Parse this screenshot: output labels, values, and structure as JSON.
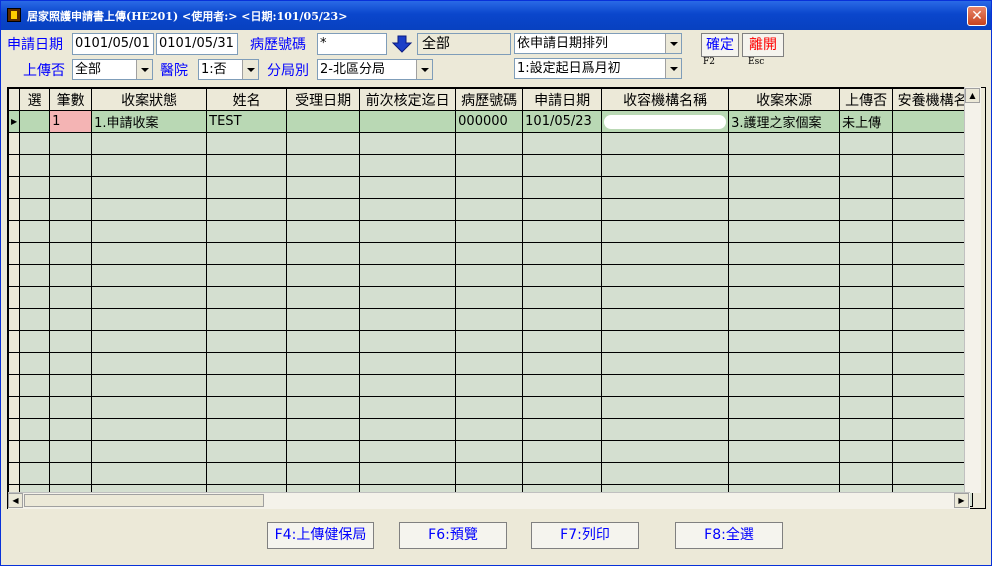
{
  "window": {
    "title": "居家照護申請書上傳(HE201)   <使用者:>    <日期:101/05/23>",
    "close": "✕"
  },
  "filters": {
    "apply_date_label": "申請日期",
    "date_from": "0101/05/01",
    "date_to": "0101/05/31",
    "record_no_label": "病歷號碼",
    "record_no_value": "*",
    "record_scope": "全部",
    "sort_option": "依申請日期排列",
    "start_option": "1:設定起日爲月初",
    "uploaded_label": "上傳否",
    "uploaded_value": "全部",
    "hospital_label": "醫院",
    "hospital_value": "1:否",
    "branch_label": "分局別",
    "branch_value": "2-北區分局"
  },
  "actions": {
    "confirm": "確定",
    "confirm_key": "F2",
    "leave": "離開",
    "leave_key": "Esc"
  },
  "table": {
    "columns": [
      "選",
      "筆數",
      "收案狀態",
      "姓名",
      "受理日期",
      "前次核定迄日",
      "病歷號碼",
      "申請日期",
      "收容機構名稱",
      "收案來源",
      "上傳否",
      "安養機構名"
    ],
    "rows": [
      [
        "",
        "1",
        "1.申請收案",
        "TEST",
        "",
        "",
        "000000",
        "101/05/23",
        "",
        "3.護理之家個案",
        "未上傳",
        ""
      ]
    ]
  },
  "footer": {
    "upload": "F4:上傳健保局",
    "preview": "F6:預覽",
    "print": "F7:列印",
    "select_all": "F8:全選"
  },
  "colors": {
    "titlebar": "#0a46cc",
    "label_blue": "#0000ff",
    "leave_red": "#ff0000",
    "grid_row": "#d4dfd0",
    "selected_row": "#b9d8b4",
    "count_cell": "#f4b4b4"
  }
}
